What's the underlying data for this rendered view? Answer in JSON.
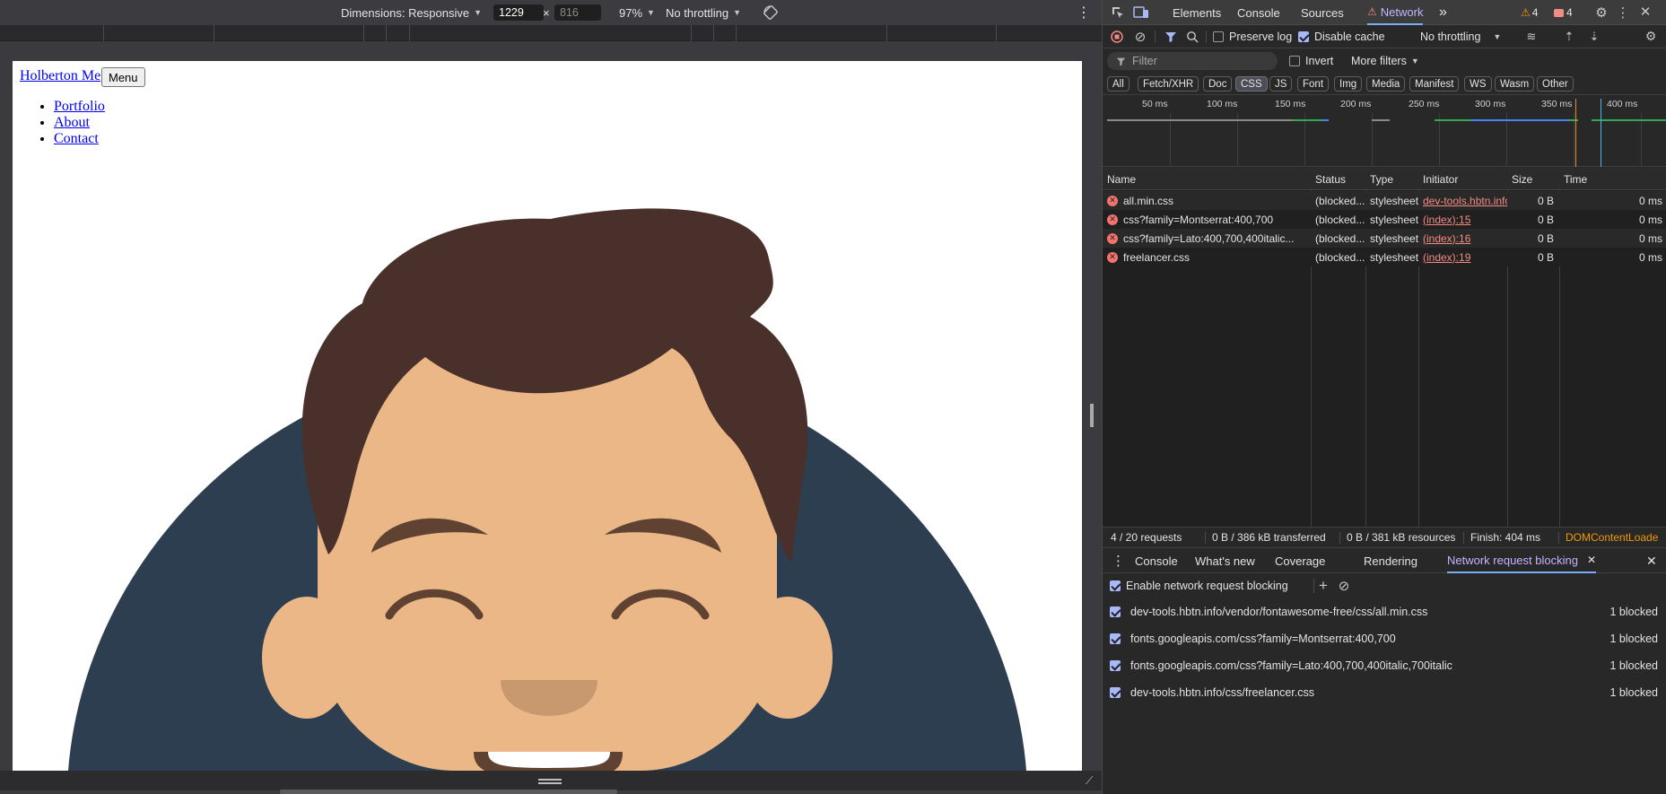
{
  "device_toolbar": {
    "dimensions_label": "Dimensions: Responsive",
    "width_value": "1229",
    "times": "×",
    "height_value": "816",
    "zoom": "97%",
    "throttle": "No throttling"
  },
  "page": {
    "brand": "Holberton Me",
    "menu_button": "Menu",
    "nav": [
      "Portfolio",
      "About",
      "Contact"
    ]
  },
  "devtools": {
    "tabs": [
      "Elements",
      "Console",
      "Sources",
      "Network"
    ],
    "active_tab": "Network",
    "more_tabs": "»",
    "warnings_count": "4",
    "errors_count": "4",
    "toolbar": {
      "preserve_log": "Preserve log",
      "disable_cache": "Disable cache",
      "throttle": "No throttling"
    },
    "filter": {
      "placeholder": "Filter",
      "invert": "Invert",
      "more_filters": "More filters"
    },
    "type_filters": [
      "All",
      "Fetch/XHR",
      "Doc",
      "CSS",
      "JS",
      "Font",
      "Img",
      "Media",
      "Manifest",
      "WS",
      "Wasm",
      "Other"
    ],
    "active_type": "CSS",
    "timeline_ticks": [
      "50 ms",
      "100 ms",
      "150 ms",
      "200 ms",
      "250 ms",
      "300 ms",
      "350 ms",
      "400 ms"
    ],
    "columns": [
      "Name",
      "Status",
      "Type",
      "Initiator",
      "Size",
      "Time"
    ],
    "rows": [
      {
        "name": "all.min.css",
        "status": "(blocked...",
        "type": "stylesheet",
        "initiator": "dev-tools.hbtn.info/",
        "size": "0 B",
        "time": "0 ms"
      },
      {
        "name": "css?family=Montserrat:400,700",
        "status": "(blocked...",
        "type": "stylesheet",
        "initiator": "(index):15",
        "size": "0 B",
        "time": "0 ms"
      },
      {
        "name": "css?family=Lato:400,700,400italic...",
        "status": "(blocked...",
        "type": "stylesheet",
        "initiator": "(index):16",
        "size": "0 B",
        "time": "0 ms"
      },
      {
        "name": "freelancer.css",
        "status": "(blocked...",
        "type": "stylesheet",
        "initiator": "(index):19",
        "size": "0 B",
        "time": "0 ms"
      }
    ],
    "status_bar": {
      "requests": "4 / 20 requests",
      "transferred": "0 B / 386 kB transferred",
      "resources": "0 B / 381 kB resources",
      "finish": "Finish: 404 ms",
      "dcl": "DOMContentLoade"
    },
    "drawer": {
      "tabs": [
        "Console",
        "What's new",
        "Coverage",
        "Rendering",
        "Network request blocking"
      ],
      "active_tab": "Network request blocking",
      "enable_label": "Enable network request blocking",
      "patterns": [
        {
          "pattern": "dev-tools.hbtn.info/vendor/fontawesome-free/css/all.min.css",
          "count": "1 blocked"
        },
        {
          "pattern": "fonts.googleapis.com/css?family=Montserrat:400,700",
          "count": "1 blocked"
        },
        {
          "pattern": "fonts.googleapis.com/css?family=Lato:400,700,400italic,700italic",
          "count": "1 blocked"
        },
        {
          "pattern": "dev-tools.hbtn.info/css/freelancer.css",
          "count": "1 blocked"
        }
      ]
    }
  },
  "colors": {
    "avatar_background": "#2c3e50",
    "hair": "#4a302b",
    "skin": "#ebb786",
    "brows": "#5f4232",
    "accent_active": "#c5b3ff",
    "error": "#f28b82"
  }
}
